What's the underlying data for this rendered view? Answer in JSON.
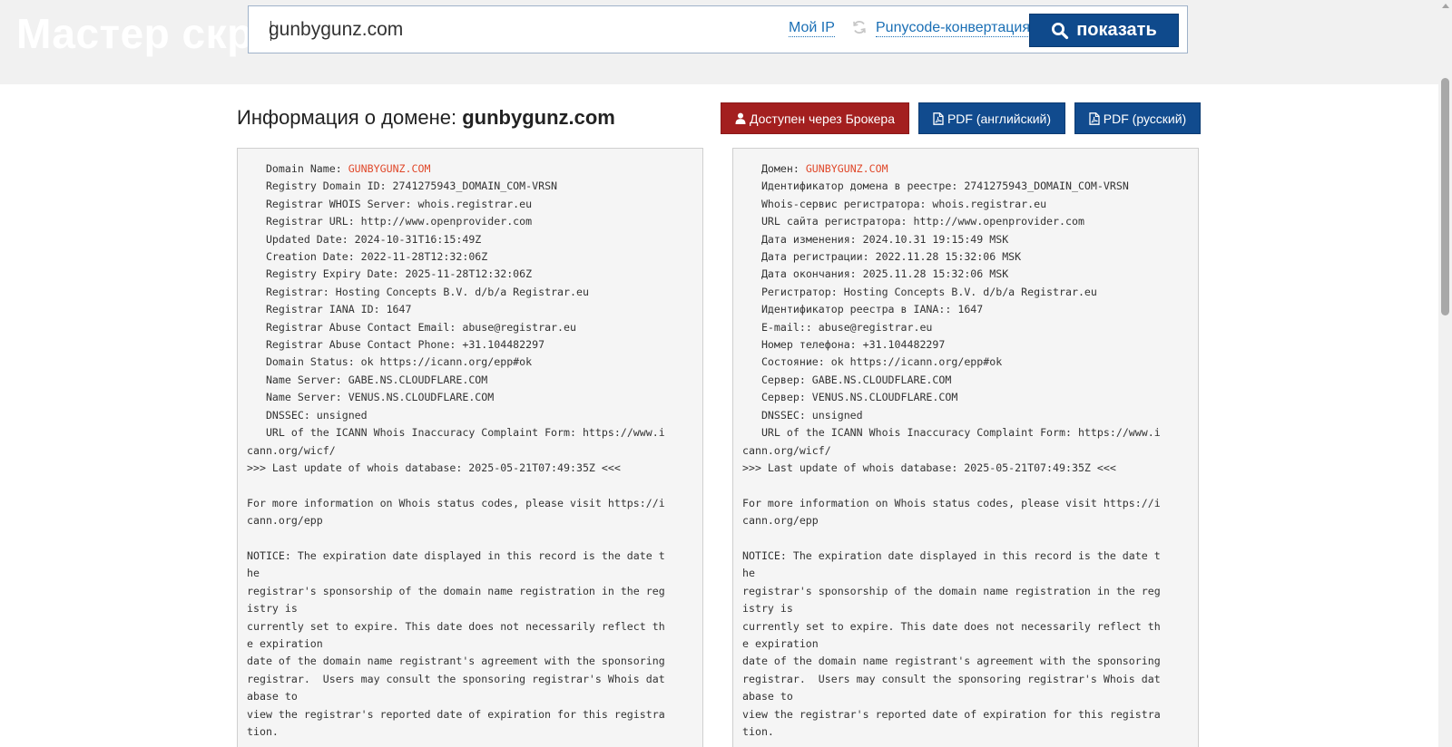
{
  "header": {
    "bg_title": "Мастер скриптов",
    "search_value": "gunbygunz.com",
    "link_my_ip": "Мой IP",
    "link_punycode": "Punycode-конвертация",
    "show_button_label": "показать"
  },
  "domain_info": {
    "title_prefix": "Информация о домене:",
    "domain": "gunbygunz.com",
    "broker_button": "Доступен через Брокера",
    "pdf_en_button": "PDF (английский)",
    "pdf_ru_button": "PDF (русский)"
  },
  "whois_en": {
    "domain_label": "   Domain Name: ",
    "domain_value": "GUNBYGUNZ.COM",
    "body": "\n   Registry Domain ID: 2741275943_DOMAIN_COM-VRSN\n   Registrar WHOIS Server: whois.registrar.eu\n   Registrar URL: http://www.openprovider.com\n   Updated Date: 2024-10-31T16:15:49Z\n   Creation Date: 2022-11-28T12:32:06Z\n   Registry Expiry Date: 2025-11-28T12:32:06Z\n   Registrar: Hosting Concepts B.V. d/b/a Registrar.eu\n   Registrar IANA ID: 1647\n   Registrar Abuse Contact Email: abuse@registrar.eu\n   Registrar Abuse Contact Phone: +31.104482297\n   Domain Status: ok https://icann.org/epp#ok\n   Name Server: GABE.NS.CLOUDFLARE.COM\n   Name Server: VENUS.NS.CLOUDFLARE.COM\n   DNSSEC: unsigned\n   URL of the ICANN Whois Inaccuracy Complaint Form: https://www.i\ncann.org/wicf/\n>>> Last update of whois database: 2025-05-21T07:49:35Z <<<\n\nFor more information on Whois status codes, please visit https://i\ncann.org/epp\n\nNOTICE: The expiration date displayed in this record is the date t\nhe\nregistrar's sponsorship of the domain name registration in the reg\nistry is\ncurrently set to expire. This date does not necessarily reflect th\ne expiration\ndate of the domain name registrant's agreement with the sponsoring\nregistrar.  Users may consult the sponsoring registrar's Whois dat\nabase to\nview the registrar's reported date of expiration for this registra\ntion."
  },
  "whois_ru": {
    "domain_label": "   Домен: ",
    "domain_value": "GUNBYGUNZ.COM",
    "body": "\n   Идентификатор домена в реестре: 2741275943_DOMAIN_COM-VRSN\n   Whois-сервис регистратора: whois.registrar.eu\n   URL сайта регистратора: http://www.openprovider.com\n   Дата изменения: 2024.10.31 19:15:49 MSK\n   Дата регистрации: 2022.11.28 15:32:06 MSK\n   Дата окончания: 2025.11.28 15:32:06 MSK\n   Регистратор: Hosting Concepts B.V. d/b/a Registrar.eu\n   Идентификатор реестра в IANA:: 1647\n   E-mail:: abuse@registrar.eu\n   Номер телефона: +31.104482297\n   Состояние: ok https://icann.org/epp#ok\n   Сервер: GABE.NS.CLOUDFLARE.COM\n   Сервер: VENUS.NS.CLOUDFLARE.COM\n   DNSSEC: unsigned\n   URL of the ICANN Whois Inaccuracy Complaint Form: https://www.i\ncann.org/wicf/\n>>> Last update of whois database: 2025-05-21T07:49:35Z <<<\n\nFor more information on Whois status codes, please visit https://i\ncann.org/epp\n\nNOTICE: The expiration date displayed in this record is the date t\nhe\nregistrar's sponsorship of the domain name registration in the reg\nistry is\ncurrently set to expire. This date does not necessarily reflect th\ne expiration\ndate of the domain name registrant's agreement with the sponsoring\nregistrar.  Users may consult the sponsoring registrar's Whois dat\nabase to\nview the registrar's reported date of expiration for this registra\ntion."
  },
  "icons": {
    "search": "search-icon",
    "refresh": "refresh-icon",
    "user": "user-icon",
    "pdf": "pdf-file-icon"
  },
  "colors": {
    "primary_button": "#0f4a8c",
    "broker_button": "#a31f1f",
    "link": "#1a6fb5",
    "domain_highlight": "#e0482a"
  }
}
